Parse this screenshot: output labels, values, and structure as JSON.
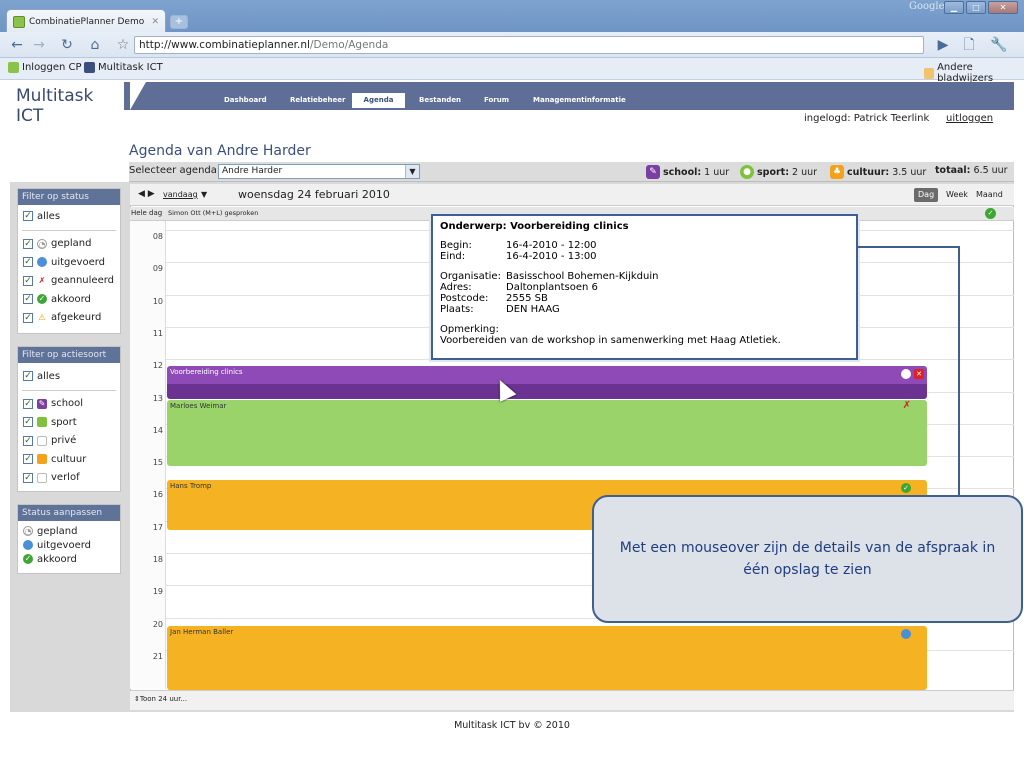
{
  "browser": {
    "tab_title": "CombinatiePlanner Demo - ...",
    "google_label": "Google",
    "url_main": "http://www.combinatieplanner.nl",
    "url_path": "/Demo/Agenda",
    "bookmarks": [
      "Inloggen CP",
      "Multitask ICT"
    ],
    "other_bookmarks": "Andere bladwijzers"
  },
  "app": {
    "logo": "Multitask ICT",
    "nav": [
      "Dashboard",
      "Relatiebeheer",
      "Agenda",
      "Bestanden",
      "Forum",
      "Managementinformatie"
    ],
    "active_nav": "Agenda",
    "logged_in": "ingelogd: Patrick Teerlink",
    "logout": "uitloggen",
    "page_title": "Agenda van Andre Harder",
    "select_label": "Selecteer agenda:",
    "select_value": "Andre Harder",
    "legend": [
      {
        "label": "school:",
        "value": "1 uur",
        "color": "#7a3fa0"
      },
      {
        "label": "sport:",
        "value": "2 uur",
        "color": "#7fc23a"
      },
      {
        "label": "cultuur:",
        "value": "3.5 uur",
        "color": "#f4a11c"
      }
    ],
    "total_label": "totaal:",
    "total_value": "6.5 uur"
  },
  "filters": {
    "status_title": "Filter op status",
    "status_all": "alles",
    "status_items": [
      "gepland",
      "uitgevoerd",
      "geannuleerd",
      "akkoord",
      "afgekeurd"
    ],
    "action_title": "Filter op actiesoort",
    "action_all": "alles",
    "action_items": [
      "school",
      "sport",
      "privé",
      "cultuur",
      "verlof"
    ],
    "adjust_title": "Status aanpassen",
    "adjust_items": [
      "gepland",
      "uitgevoerd",
      "akkoord"
    ]
  },
  "calendar": {
    "today_link": "vandaag",
    "date_title": "woensdag 24 februari 2010",
    "views": [
      "Dag",
      "Week",
      "Maand"
    ],
    "allday_label": "Hele dag",
    "allday_event": "Simon Ott (M+L) gesproken",
    "hours": [
      "08",
      "09",
      "10",
      "11",
      "12",
      "13",
      "14",
      "15",
      "16",
      "17",
      "18",
      "19",
      "20",
      "21"
    ],
    "events": [
      {
        "title": "Voorbereiding clinics",
        "color": "#8e4bb8"
      },
      {
        "title": "Marloes Weimar",
        "color": "#9ad36a"
      },
      {
        "title": "Hans Tromp",
        "color": "#f5b222"
      },
      {
        "title": "Jan Herman Baller",
        "color": "#f5b222"
      }
    ],
    "show24": "Toon 24 uur..."
  },
  "tooltip": {
    "subject": "Onderwerp: Voorbereiding clinics",
    "begin_label": "Begin:",
    "begin": "16-4-2010 - 12:00",
    "end_label": "Eind:",
    "end": "16-4-2010 - 13:00",
    "org_label": "Organisatie:",
    "org": "Basisschool Bohemen-Kijkduin",
    "addr_label": "Adres:",
    "addr": "Daltonplantsoen 6",
    "zip_label": "Postcode:",
    "zip": "2555 SB",
    "city_label": "Plaats:",
    "city": "DEN HAAG",
    "note_label": "Opmerking:",
    "note": "Voorbereiden van de workshop in samenwerking met Haag Atletiek."
  },
  "callout": "Met een mouseover zijn de details van de afspraak in één opslag te zien",
  "footer": "Multitask ICT bv © 2010"
}
